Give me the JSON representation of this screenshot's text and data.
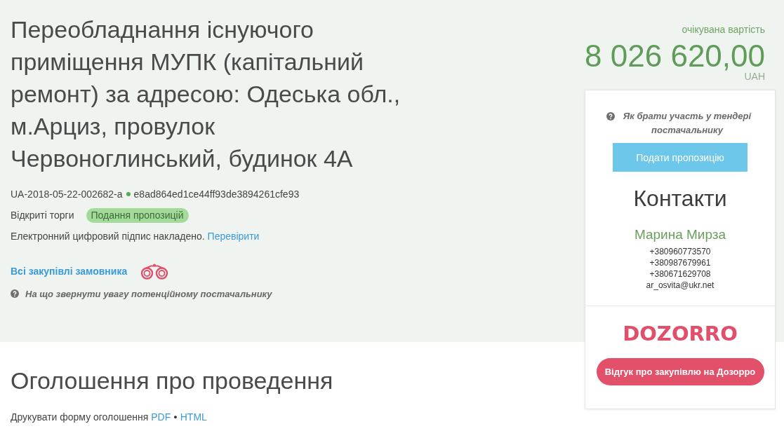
{
  "tender": {
    "title": "Переобладнання існуючого приміщення МУПК (капітальний ремонт) за адресою: Одеська обл., м.Арциз, провулок Червоноглинський, будинок 4А",
    "id": "UA-2018-05-22-002682-a",
    "hash": "e8ad864ed1ce44ff93de3894261cfe93",
    "procedure_type": "Відкриті торги",
    "status": "Подання пропозицій",
    "signature_note": "Електронний цифровий підпис накладено.",
    "signature_link": "Перевірити",
    "buyer_link": "Всі закупівлі замовника",
    "supplier_hint": "На що звернути увагу потенційному постачальнику"
  },
  "value": {
    "label": "очікувана вартість",
    "amount": "8 026 620,00",
    "currency": "UAH"
  },
  "sidebar": {
    "help_link": "Як брати участь у тендері постачальнику",
    "submit_button": "Подати пропозицію",
    "contacts_title": "Контакти",
    "contact_name": "Марина Мирза",
    "contact_lines": [
      "+380960773570",
      "+380987679961",
      "+380671629708",
      "ar_osvita@ukr.net"
    ],
    "logo": "DOZORRO",
    "review_button": "Відгук про закупівлю на Дозорро"
  },
  "announcement": {
    "title": "Оголошення про проведення",
    "print_label": "Друкувати форму оголошення",
    "formats": [
      "PDF",
      "HTML"
    ],
    "separator": "●"
  }
}
